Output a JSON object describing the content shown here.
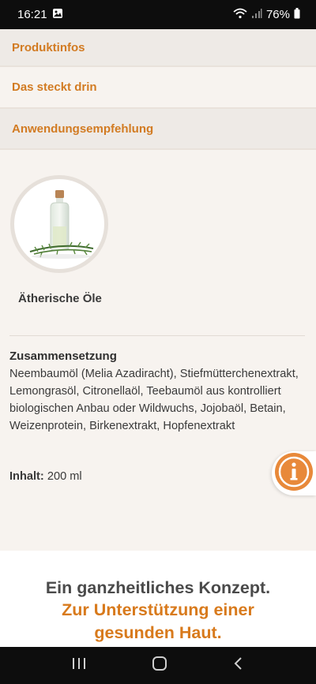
{
  "status": {
    "time": "16:21",
    "battery": "76%"
  },
  "accordion": [
    {
      "label": "Produktinfos"
    },
    {
      "label": "Das steckt drin"
    },
    {
      "label": "Anwendungsempfehlung"
    }
  ],
  "product": {
    "label": "Ätherische Öle",
    "icon": "essential-oil-bottle"
  },
  "composition": {
    "title": "Zusammensetzung",
    "text": "Neembaumöl (Melia Azadiracht), Stiefmütterchenextrakt, Lemongrasöl, Citronellaöl, Teebaumöl aus kontrolliert biologischen Anbau oder Wildwuchs, Jojobaöl, Betain, Weizenprotein, Birkenextrakt, Hopfenextrakt"
  },
  "content": {
    "label": "Inhalt:",
    "value": " 200 ml"
  },
  "promo": {
    "headline": "Ein ganzheitliches Konzept.",
    "sub_line1": "Zur Unterstützung einer",
    "sub_line2": "gesunden Haut."
  },
  "colors": {
    "accent": "#d87a1c",
    "background": "#f7f3ef",
    "panel": "#eeeae6"
  }
}
